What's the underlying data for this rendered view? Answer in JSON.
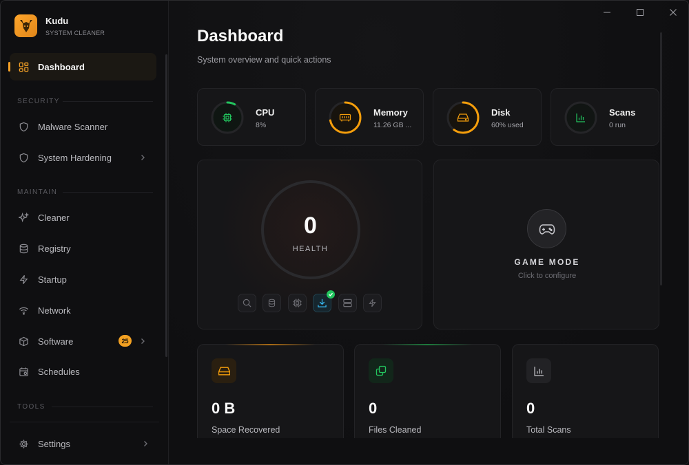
{
  "brand": {
    "name": "Kudu",
    "subtitle": "SYSTEM CLEANER"
  },
  "sidebar": {
    "active": {
      "label": "Dashboard",
      "icon": "dashboard-grid-icon"
    },
    "sections": [
      "SECURITY",
      "MAINTAIN",
      "TOOLS"
    ],
    "items": [
      {
        "label": "Malware Scanner",
        "icon": "shield-icon"
      },
      {
        "label": "System Hardening",
        "icon": "shield-icon",
        "chevron": true
      },
      {
        "label": "Cleaner",
        "icon": "sparkles-icon"
      },
      {
        "label": "Registry",
        "icon": "database-icon"
      },
      {
        "label": "Startup",
        "icon": "lightning-icon"
      },
      {
        "label": "Network",
        "icon": "wifi-icon"
      },
      {
        "label": "Software",
        "icon": "package-icon",
        "badge": "25",
        "chevron": true
      },
      {
        "label": "Schedules",
        "icon": "calendar-icon"
      }
    ],
    "settings": {
      "label": "Settings",
      "icon": "gear-icon"
    }
  },
  "page": {
    "title": "Dashboard",
    "subtitle": "System overview and quick actions"
  },
  "stats": [
    {
      "title": "CPU",
      "value": "8%",
      "icon": "cpu-chip-icon",
      "color": "#22c55e",
      "fill": 0.08
    },
    {
      "title": "Memory",
      "value": "11.26 GB ...",
      "icon": "memory-icon",
      "color": "#f59e0b",
      "fill": 0.72
    },
    {
      "title": "Disk",
      "value": "60% used",
      "icon": "hard-drive-icon",
      "color": "#f59e0b",
      "fill": 0.6
    },
    {
      "title": "Scans",
      "value": "0 run",
      "icon": "bar-chart-icon",
      "color": "#22c55e",
      "fill": 0
    }
  ],
  "health": {
    "value": "0",
    "label": "HEALTH"
  },
  "game_mode": {
    "title": "GAME MODE",
    "subtitle": "Click to configure"
  },
  "summary": [
    {
      "value": "0 B",
      "label": "Space Recovered",
      "icon": "hard-drive-icon",
      "color": "#f59e0b"
    },
    {
      "value": "0",
      "label": "Files Cleaned",
      "icon": "copy-files-icon",
      "color": "#22c55e"
    },
    {
      "value": "0",
      "label": "Total Scans",
      "icon": "bar-chart-icon",
      "color": "#a1a1aa"
    }
  ],
  "colors": {
    "accent": "#f4a026",
    "success": "#22c55e",
    "info": "#38bdf8"
  }
}
